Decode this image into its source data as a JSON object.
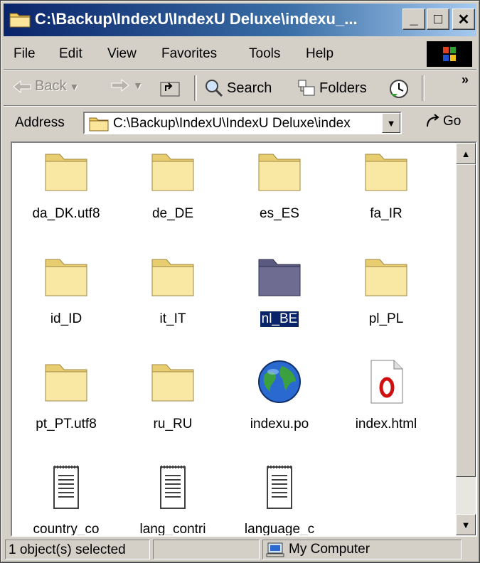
{
  "window": {
    "title": "C:\\Backup\\IndexU\\IndexU Deluxe\\indexu_...",
    "minimize": "_",
    "maximize": "□",
    "close": "✕"
  },
  "menu": [
    "File",
    "Edit",
    "View",
    "Favorites",
    "Tools",
    "Help"
  ],
  "toolbar": {
    "back": "Back",
    "search": "Search",
    "folders": "Folders",
    "more": "»"
  },
  "address": {
    "label": "Address",
    "value": "C:\\Backup\\IndexU\\IndexU Deluxe\\index",
    "go": "Go"
  },
  "files": [
    {
      "name": "da_DK.utf8",
      "type": "folder"
    },
    {
      "name": "de_DE",
      "type": "folder"
    },
    {
      "name": "es_ES",
      "type": "folder"
    },
    {
      "name": "fa_IR",
      "type": "folder"
    },
    {
      "name": "id_ID",
      "type": "folder"
    },
    {
      "name": "it_IT",
      "type": "folder"
    },
    {
      "name": "nl_BE",
      "type": "folder",
      "selected": true
    },
    {
      "name": "pl_PL",
      "type": "folder"
    },
    {
      "name": "pt_PT.utf8",
      "type": "folder"
    },
    {
      "name": "ru_RU",
      "type": "folder"
    },
    {
      "name": "indexu.po",
      "type": "globe"
    },
    {
      "name": "index.html",
      "type": "opera-document"
    },
    {
      "name": "country_co",
      "type": "text-document"
    },
    {
      "name": "lang_contri",
      "type": "text-document"
    },
    {
      "name": "language_c",
      "type": "text-document"
    }
  ],
  "status": {
    "selection": "1 object(s) selected",
    "zone": "My Computer"
  },
  "colors": {
    "titlebar": "#0a246a",
    "face": "#d4d0c8",
    "folder": "#f4e08c",
    "selected": "#0a246a"
  }
}
